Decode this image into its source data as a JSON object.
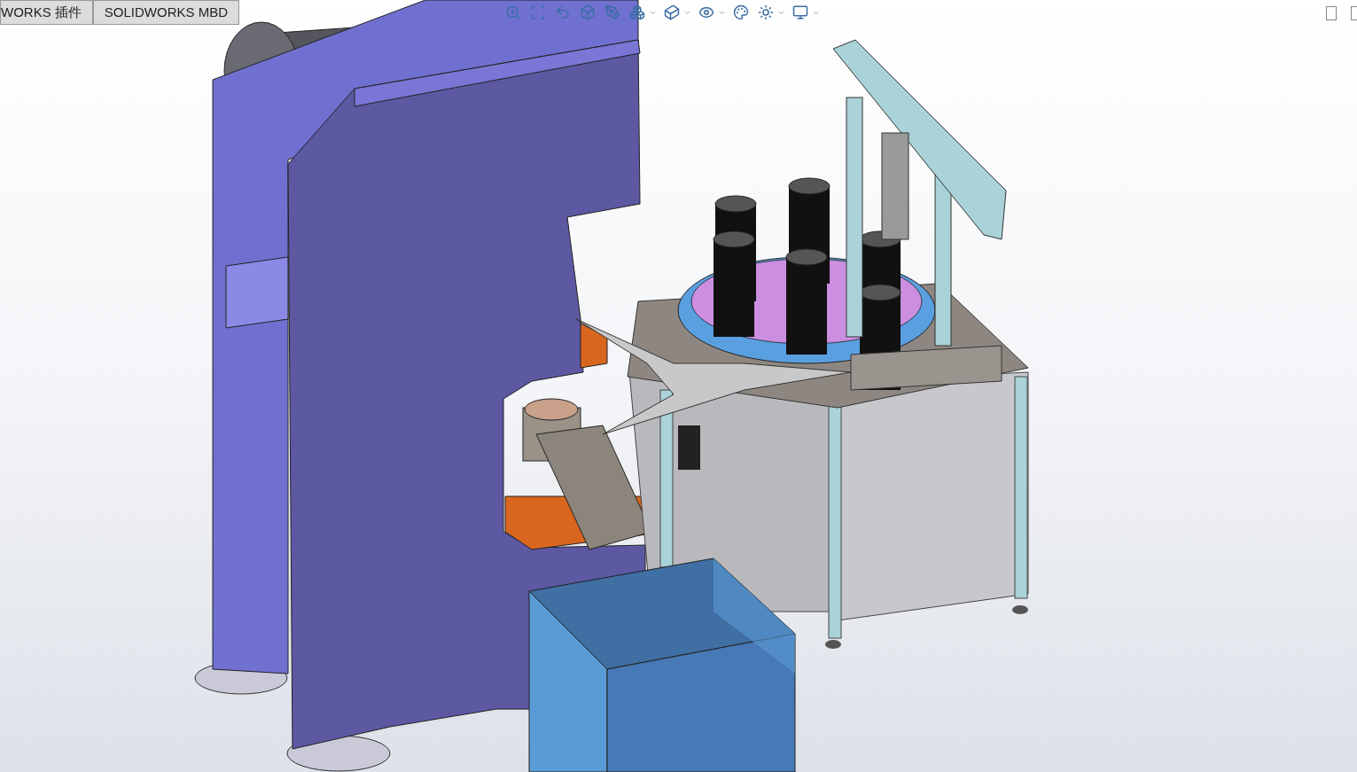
{
  "tabs": [
    {
      "label": "WORKS 插件"
    },
    {
      "label": "SOLIDWORKS MBD"
    }
  ],
  "heads_up_toolbar": [
    {
      "kind": "zoomfit",
      "dropdown": false
    },
    {
      "kind": "zoomarea",
      "dropdown": false
    },
    {
      "kind": "previous",
      "dropdown": false
    },
    {
      "kind": "section",
      "dropdown": false
    },
    {
      "kind": "annotation",
      "dropdown": false
    },
    {
      "kind": "orientation",
      "dropdown": true
    },
    {
      "kind": "display",
      "dropdown": true
    },
    {
      "kind": "visibility",
      "dropdown": true
    },
    {
      "kind": "appearance",
      "dropdown": false
    },
    {
      "kind": "scene",
      "dropdown": true
    },
    {
      "kind": "view",
      "dropdown": true
    }
  ]
}
